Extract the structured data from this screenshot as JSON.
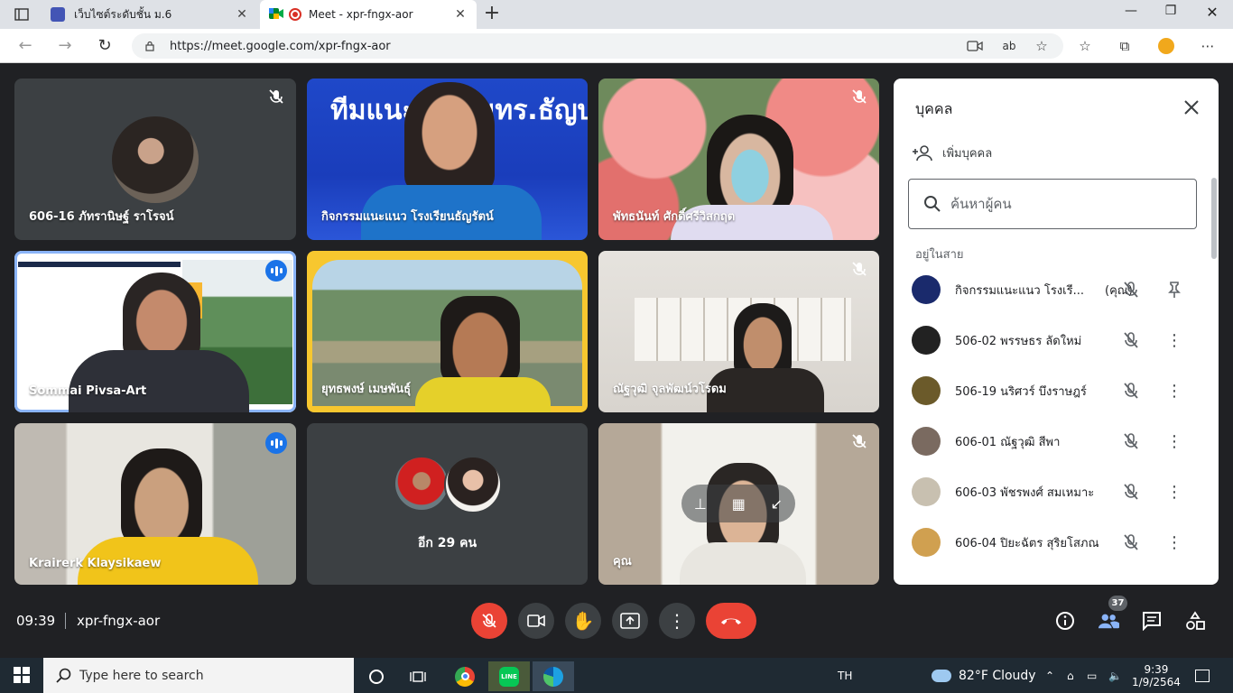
{
  "browser": {
    "tabs": [
      {
        "title": "เว็บไซต์ระดับชั้น ม.6",
        "active": false
      },
      {
        "title": "Meet - xpr-fngx-aor",
        "active": true
      }
    ],
    "url": "https://meet.google.com/xpr-fngx-aor"
  },
  "meet": {
    "tiles": [
      {
        "name": "606-16 ภัทรานิษฐ์ ราโรจน์",
        "state": "muted"
      },
      {
        "name": "กิจกรรมแนะแนว โรงเรียนธัญรัตน์",
        "state": "none",
        "banner": "ทีมแนะแนว มทร.ธัญบุรี"
      },
      {
        "name": "พัทธนันท์ ศักดิ์ศรีวิสกฤต",
        "state": "muted"
      },
      {
        "name": "Sommai Pivsa-Art",
        "state": "speaking"
      },
      {
        "name": "ยุทธพงษ์ เมษพันธุ์",
        "state": "none"
      },
      {
        "name": "ณัฐวุฒิ จุลพัฒน์วโรดม",
        "state": "muted"
      },
      {
        "name": "Krairerk Klaysikaew",
        "state": "speaking"
      },
      {
        "name": "อีก 29 คน",
        "state": "group"
      },
      {
        "name": "คุณ",
        "state": "muted"
      }
    ],
    "people_panel": {
      "title": "บุคคล",
      "add_label": "เพิ่มบุคคล",
      "search_placeholder": "ค้นหาผู้คน",
      "section": "อยู่ในสาย",
      "you_label": "(คุณ)",
      "people": [
        {
          "name": "กิจกรรมแนะแนว โรงเรี...",
          "avatar_color": "#1a2a6c"
        },
        {
          "name": "506-02 พรรษธร ลัดใหม่",
          "avatar_color": "#222222"
        },
        {
          "name": "506-19 นริศวร์ บึงราษฎร์",
          "avatar_color": "#6b5a2a"
        },
        {
          "name": "606-01 ณัฐวุฒิ สีพา",
          "avatar_color": "#7a6a60"
        },
        {
          "name": "606-03 พัชรพงศ์ สมเหมาะ",
          "avatar_color": "#c8c0b0"
        },
        {
          "name": "606-04 ปิยะฉัตร สุริยโสภณ",
          "avatar_color": "#d0a050"
        }
      ]
    },
    "bottom": {
      "time": "09:39",
      "code": "xpr-fngx-aor",
      "participant_count": "37"
    }
  },
  "taskbar": {
    "search_placeholder": "Type here to search",
    "language": "TH",
    "weather": "82°F  Cloudy",
    "time": "9:39",
    "date": "1/9/2564"
  }
}
